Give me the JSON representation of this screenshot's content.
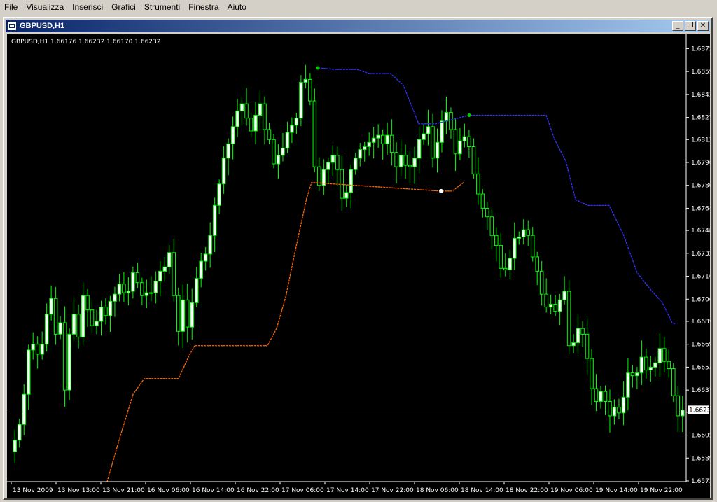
{
  "menu": [
    "File",
    "Visualizza",
    "Inserisci",
    "Grafici",
    "Strumenti",
    "Finestra",
    "Aiuto"
  ],
  "window": {
    "title": "GBPUSD,H1",
    "buttons": {
      "minimize": "_",
      "restore": "❐",
      "close": "✕"
    }
  },
  "chart_info": "GBPUSD,H1  1.66176 1.66232 1.66170 1.66232",
  "colors": {
    "background": "#000000",
    "candle": "#00ff00",
    "bull_body": "#ffffff",
    "bear_body": "#000000",
    "sar_up": "#ff6600",
    "sar_down": "#3333ff",
    "grid_line": "#ffffff"
  },
  "chart_data": {
    "type": "candlestick",
    "symbol": "GBPUSD",
    "timeframe": "H1",
    "current_price": "1.66232",
    "ylim": [
      1.6573,
      1.6885
    ],
    "y_ticks": [
      "1.68755",
      "1.68595",
      "1.68435",
      "1.68275",
      "1.68120",
      "1.67960",
      "1.67800",
      "1.67640",
      "1.67485",
      "1.67325",
      "1.67165",
      "1.67005",
      "1.66850",
      "1.66690",
      "1.66530",
      "1.66370",
      "1.66215",
      "1.66055",
      "1.65895",
      "1.65735"
    ],
    "x_ticks": [
      "13 Nov 2009",
      "13 Nov 13:00",
      "13 Nov 21:00",
      "16 Nov 06:00",
      "16 Nov 14:00",
      "16 Nov 22:00",
      "17 Nov 06:00",
      "17 Nov 14:00",
      "17 Nov 22:00",
      "18 Nov 06:00",
      "18 Nov 14:00",
      "18 Nov 22:00",
      "19 Nov 06:00",
      "19 Nov 14:00",
      "19 Nov 22:00"
    ],
    "closes": [
      1.6602,
      1.6613,
      1.6634,
      1.6665,
      1.6669,
      1.6662,
      1.6669,
      1.669,
      1.6701,
      1.6676,
      1.6684,
      1.6637,
      1.6676,
      1.669,
      1.6674,
      1.6703,
      1.6693,
      1.6682,
      1.6685,
      1.6695,
      1.6689,
      1.6699,
      1.6704,
      1.6711,
      1.6705,
      1.6706,
      1.6719,
      1.6712,
      1.6703,
      1.6705,
      1.6705,
      1.6713,
      1.672,
      1.6723,
      1.6733,
      1.6703,
      1.6678,
      1.67,
      1.6681,
      1.6698,
      1.6715,
      1.6727,
      1.6732,
      1.6745,
      1.6766,
      1.6781,
      1.6799,
      1.6809,
      1.6821,
      1.6832,
      1.6837,
      1.6827,
      1.6818,
      1.6829,
      1.6837,
      1.6819,
      1.6812,
      1.6795,
      1.6801,
      1.6806,
      1.6817,
      1.6822,
      1.6827,
      1.6852,
      1.6854,
      1.6839,
      1.6793,
      1.678,
      1.6791,
      1.6796,
      1.6801,
      1.6791,
      1.6771,
      1.6775,
      1.6791,
      1.6799,
      1.6805,
      1.6807,
      1.681,
      1.6813,
      1.6815,
      1.6809,
      1.6815,
      1.6803,
      1.6793,
      1.6801,
      1.6794,
      1.6793,
      1.6799,
      1.6812,
      1.6816,
      1.6821,
      1.6799,
      1.681,
      1.6825,
      1.6831,
      1.6819,
      1.6802,
      1.6811,
      1.6814,
      1.6807,
      1.6788,
      1.6774,
      1.6764,
      1.6758,
      1.6745,
      1.6738,
      1.6722,
      1.6721,
      1.6729,
      1.6743,
      1.6744,
      1.6749,
      1.6745,
      1.673,
      1.672,
      1.6704,
      1.6695,
      1.6697,
      1.6692,
      1.67,
      1.6706,
      1.6668,
      1.667,
      1.668,
      1.6676,
      1.6659,
      1.6638,
      1.6629,
      1.6636,
      1.6629,
      1.6619,
      1.6625,
      1.6621,
      1.6632,
      1.6649,
      1.6647,
      1.6649,
      1.666,
      1.6651,
      1.6653,
      1.6656,
      1.6666,
      1.6657,
      1.6652,
      1.6633,
      1.6619,
      1.6623
    ]
  },
  "sar": {
    "up": [
      [
        143,
        1.6573
      ],
      [
        160,
        1.6602
      ],
      [
        180,
        1.6634
      ],
      [
        196,
        1.6645
      ],
      [
        245,
        1.6645
      ],
      [
        260,
        1.6661
      ],
      [
        268,
        1.6668
      ],
      [
        372,
        1.6668
      ],
      [
        385,
        1.668
      ],
      [
        398,
        1.6702
      ],
      [
        412,
        1.6735
      ],
      [
        428,
        1.6771
      ],
      [
        435,
        1.6782
      ],
      [
        620,
        1.6776
      ],
      [
        636,
        1.6776
      ],
      [
        652,
        1.6782
      ]
    ],
    "down": [
      [
        444,
        1.6862
      ],
      [
        470,
        1.6861
      ],
      [
        500,
        1.6861
      ],
      [
        518,
        1.6858
      ],
      [
        548,
        1.6858
      ],
      [
        566,
        1.685
      ],
      [
        588,
        1.6823
      ],
      [
        612,
        1.6823
      ],
      [
        660,
        1.6829
      ],
      [
        770,
        1.6829
      ],
      [
        782,
        1.6812
      ],
      [
        798,
        1.6797
      ],
      [
        812,
        1.677
      ],
      [
        830,
        1.6766
      ],
      [
        860,
        1.6766
      ],
      [
        880,
        1.6746
      ],
      [
        900,
        1.6719
      ],
      [
        916,
        1.6709
      ],
      [
        936,
        1.6698
      ],
      [
        950,
        1.6684
      ],
      [
        956,
        1.6683
      ]
    ]
  }
}
